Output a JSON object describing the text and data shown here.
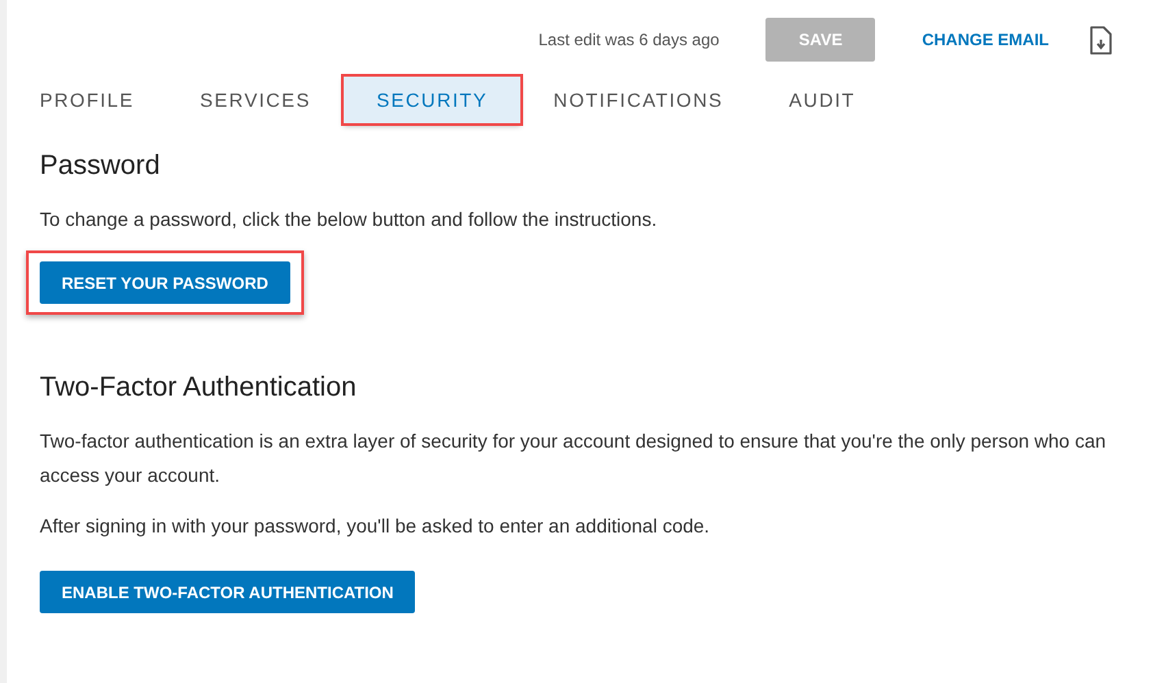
{
  "header": {
    "last_edit": "Last edit was 6 days ago",
    "save": {
      "label": "SAVE",
      "disabled": true
    },
    "change_email": "CHANGE EMAIL"
  },
  "tabs": [
    {
      "label": "PROFILE",
      "selected": false,
      "highlighted": false
    },
    {
      "label": "SERVICES",
      "selected": false,
      "highlighted": false
    },
    {
      "label": "SECURITY",
      "selected": true,
      "highlighted": true
    },
    {
      "label": "NOTIFICATIONS",
      "selected": false,
      "highlighted": false
    },
    {
      "label": "AUDIT",
      "selected": false,
      "highlighted": false
    }
  ],
  "password": {
    "title": "Password",
    "text": "To change a password, click the below button and follow the instructions.",
    "button": {
      "label": "RESET YOUR PASSWORD",
      "highlighted": true
    }
  },
  "two_factor": {
    "title": "Two-Factor Authentication",
    "paragraphs": [
      "Two-factor authentication is an extra layer of security for your account designed to ensure that you're the only person who can access your account.",
      "After signing in with your password, you'll be asked to enter an additional code."
    ],
    "button": {
      "label": "ENABLE TWO-FACTOR AUTHENTICATION"
    }
  }
}
